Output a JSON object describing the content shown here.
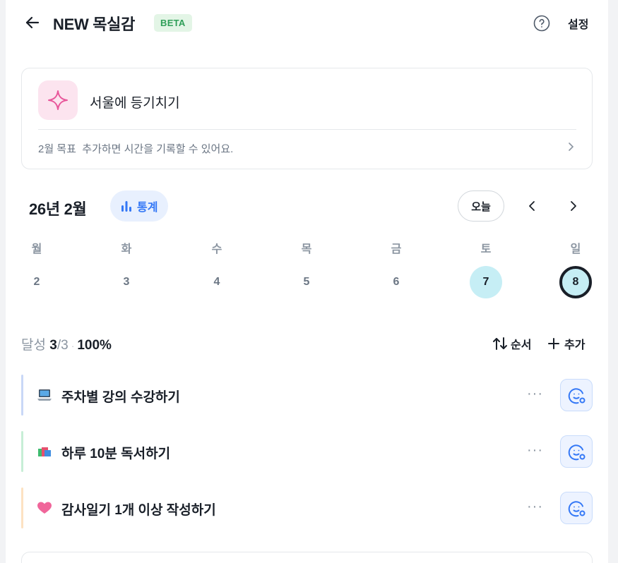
{
  "header": {
    "title": "NEW 목실감",
    "badge": "BETA",
    "settings_label": "설정"
  },
  "goal_card": {
    "title": "서울에 등기치기",
    "month_goal": "2월 목표",
    "subtitle": "추가하면 시간을 기록할 수 있어요."
  },
  "calendar": {
    "month_label": "26년 2월",
    "stats_label": "통계",
    "today_label": "오늘",
    "weekdays": [
      "월",
      "화",
      "수",
      "목",
      "금",
      "토",
      "일"
    ],
    "days": [
      "2",
      "3",
      "4",
      "5",
      "6",
      "7",
      "8"
    ],
    "achieved_days": [
      "7"
    ],
    "today": "8"
  },
  "progress": {
    "label": "달성",
    "done": "3",
    "total": "/3",
    "percent": "100%",
    "order_label": "순서",
    "add_label": "추가"
  },
  "tasks": [
    {
      "label": "주차별 강의 수강하기",
      "icon": "laptop-icon",
      "bar_color": "#c9d8f7"
    },
    {
      "label": "하루 10분 독서하기",
      "icon": "books-icon",
      "bar_color": "#c7eed6"
    },
    {
      "label": "감사일기 1개 이상 작성하기",
      "icon": "heart-icon",
      "bar_color": "#fde2c2"
    }
  ],
  "colors": {
    "accent": "#3478f6",
    "badge_bg": "#e3f5e6",
    "badge_text": "#2f9e58",
    "achieved_day": "#c6eef5"
  }
}
